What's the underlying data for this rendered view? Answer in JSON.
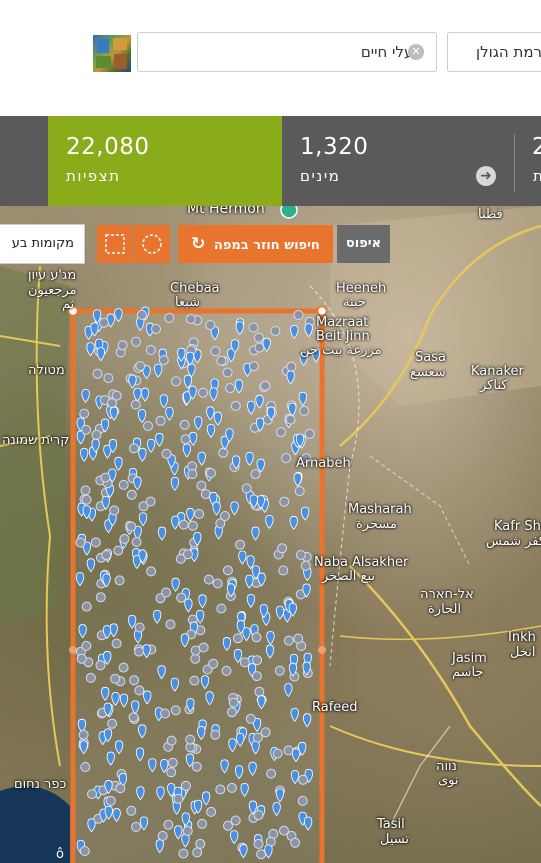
{
  "search": {
    "species_value": "בעלי חיים",
    "clear_glyph": "✕",
    "location_value": "רמת הגולן"
  },
  "stats": {
    "observations": {
      "count": "22,080",
      "label": "תצפיות"
    },
    "species": {
      "count": "1,320",
      "label": "מינים"
    },
    "third": {
      "count": "2",
      "label": "ת"
    },
    "next_glyph": "➜"
  },
  "map": {
    "reset_button": "איפוס",
    "search_again_button": "חיפוש חוזר במפה",
    "places_button": "מקומות בע",
    "labels": [
      {
        "text": "Mt Hermon",
        "name": "label-mt-hermon"
      },
      {
        "text": "قطنا",
        "name": "label-qatana"
      },
      {
        "text": "מג'ע עיון",
        "name": "label-majdal-ayoun"
      },
      {
        "text": "مرجعيون",
        "name": "label-marjayoun-ar"
      },
      {
        "text": "Chebaa",
        "name": "label-chebaa"
      },
      {
        "text": "شبعا",
        "name": "label-chebaa-ar"
      },
      {
        "text": "Heeneh",
        "name": "label-heeneh"
      },
      {
        "text": "حينة",
        "name": "label-heeneh-ar"
      },
      {
        "text": "Mazraat",
        "name": "label-mazraat"
      },
      {
        "text": "Beit Jinn",
        "name": "label-beit-jinn"
      },
      {
        "text": "مزرعة بيت جن",
        "name": "label-mazraat-ar"
      },
      {
        "text": "מטולה",
        "name": "label-metula"
      },
      {
        "text": "Sasa",
        "name": "label-sasa"
      },
      {
        "text": "سعسع",
        "name": "label-sasa-ar"
      },
      {
        "text": "Kanaker",
        "name": "label-kanaker"
      },
      {
        "text": "كناكر",
        "name": "label-kanaker-ar"
      },
      {
        "text": "קרית שמונה",
        "name": "label-kiryat-shmona"
      },
      {
        "text": "Arnabeh",
        "name": "label-arnabeh"
      },
      {
        "text": "Masharah",
        "name": "label-masharah"
      },
      {
        "text": "مسحرة",
        "name": "label-masharah-ar"
      },
      {
        "text": "Kafr Sham",
        "name": "label-kafr-sham"
      },
      {
        "text": "كفر شمس",
        "name": "label-kafr-sham-ar"
      },
      {
        "text": "Naba Alsakher",
        "name": "label-naba-alsakher"
      },
      {
        "text": "نبع الصخر",
        "name": "label-naba-alsakher-ar"
      },
      {
        "text": "אל-חארה",
        "name": "label-al-hara"
      },
      {
        "text": "الحارة",
        "name": "label-al-hara-ar"
      },
      {
        "text": "Jasim",
        "name": "label-jasim"
      },
      {
        "text": "جاسم",
        "name": "label-jasim-ar"
      },
      {
        "text": "Inkh",
        "name": "label-inkhil"
      },
      {
        "text": "انخل",
        "name": "label-inkhil-ar"
      },
      {
        "text": "Rafeed",
        "name": "label-rafeed"
      },
      {
        "text": "כפר נחום",
        "name": "label-kfar-nahum"
      },
      {
        "text": "נווה",
        "name": "label-nawa"
      },
      {
        "text": "نوى",
        "name": "label-nawa-ar"
      },
      {
        "text": "Tasil",
        "name": "label-tasil"
      },
      {
        "text": "تسيل",
        "name": "label-tasil-ar"
      },
      {
        "text": "ثم",
        "name": "label-partial"
      }
    ]
  },
  "colors": {
    "accent_green": "#8aac1a",
    "accent_orange": "#e8742e",
    "pin_blue": "#4a90e2",
    "stats_bg": "#5a5a5a"
  }
}
